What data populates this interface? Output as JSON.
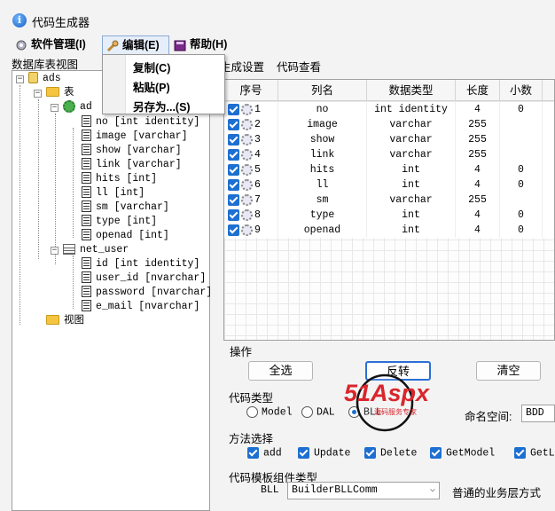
{
  "window": {
    "title": "代码生成器"
  },
  "menu": {
    "items": [
      {
        "label": "软件管理(I)",
        "icon": "gear-icon"
      },
      {
        "label": "编辑(E)",
        "icon": "wrench-icon"
      },
      {
        "label": "帮助(H)",
        "icon": "book-icon"
      }
    ],
    "dropdown": [
      "复制(C)",
      "粘贴(P)",
      "另存为...(S)"
    ]
  },
  "left": {
    "label": "数据库表视图",
    "tree": {
      "db": "ads",
      "tables_folder": "表",
      "table_ad": "ad",
      "ad_columns": [
        "no  [int identity]",
        "image  [varchar]",
        "show  [varchar]",
        "link  [varchar]",
        "hits  [int]",
        "ll  [int]",
        "sm  [varchar]",
        "type  [int]",
        "openad  [int]"
      ],
      "table_net_user": "net_user",
      "net_user_columns": [
        "id  [int identity]",
        "user_id  [nvarchar]",
        "password  [nvarchar]",
        "e_mail  [nvarchar]"
      ],
      "views_folder": "视图"
    }
  },
  "tabs": [
    "生成设置",
    "代码查看"
  ],
  "grid": {
    "headers": [
      "序号",
      "列名",
      "数据类型",
      "长度",
      "小数"
    ],
    "rows": [
      {
        "no": "1",
        "name": "no",
        "type": "int identity",
        "len": "4",
        "dec": "0"
      },
      {
        "no": "2",
        "name": "image",
        "type": "varchar",
        "len": "255",
        "dec": ""
      },
      {
        "no": "3",
        "name": "show",
        "type": "varchar",
        "len": "255",
        "dec": ""
      },
      {
        "no": "4",
        "name": "link",
        "type": "varchar",
        "len": "255",
        "dec": ""
      },
      {
        "no": "5",
        "name": "hits",
        "type": "int",
        "len": "4",
        "dec": "0"
      },
      {
        "no": "6",
        "name": "ll",
        "type": "int",
        "len": "4",
        "dec": "0"
      },
      {
        "no": "7",
        "name": "sm",
        "type": "varchar",
        "len": "255",
        "dec": ""
      },
      {
        "no": "8",
        "name": "type",
        "type": "int",
        "len": "4",
        "dec": "0"
      },
      {
        "no": "9",
        "name": "openad",
        "type": "int",
        "len": "4",
        "dec": "0"
      }
    ]
  },
  "operations": {
    "label": "操作",
    "select_all": "全选",
    "invert": "反转",
    "clear": "清空"
  },
  "code_type": {
    "label": "代码类型",
    "options": [
      "Model",
      "DAL",
      "BLL"
    ],
    "selected": "BLL",
    "namespace_label": "命名空间:",
    "namespace_value": "BDD"
  },
  "methods": {
    "label": "方法选择",
    "options": [
      "add",
      "Update",
      "Delete",
      "GetModel",
      "GetLi"
    ]
  },
  "template": {
    "label": "代码模板组件类型",
    "bll_label": "BLL",
    "bll_value": "BuilderBLLComm",
    "description": "普通的业务层方式"
  },
  "watermark": {
    "main": "51Aspx",
    "sub": "源码服务专家"
  },
  "colors": {
    "accent": "#1d6fd1",
    "watermark_red": "#d9262c"
  }
}
